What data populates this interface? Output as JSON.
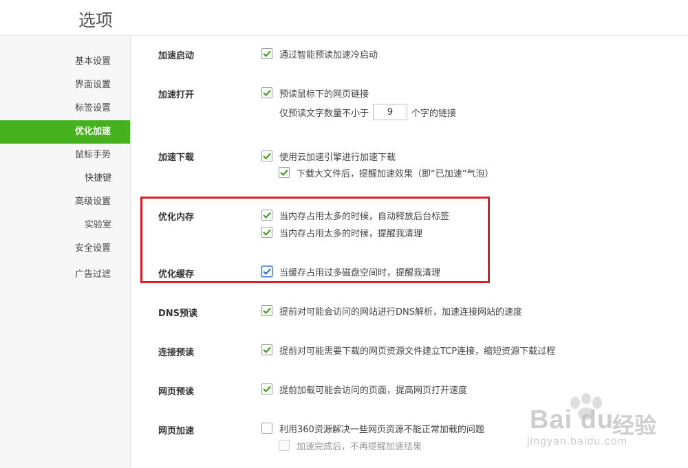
{
  "header": {
    "title": "选项"
  },
  "sidebar": {
    "items": [
      {
        "label": "基本设置"
      },
      {
        "label": "界面设置"
      },
      {
        "label": "标签设置"
      },
      {
        "label": "优化加速",
        "active": true
      },
      {
        "label": "鼠标手势"
      },
      {
        "label": "快捷键"
      },
      {
        "label": "高级设置"
      },
      {
        "label": "实验室"
      },
      {
        "label": "安全设置"
      },
      {
        "label": "广告过滤"
      }
    ]
  },
  "sections": {
    "accel_start": {
      "label": "加速启动",
      "opt1": {
        "label": "通过智能预读加速冷启动",
        "checked": true
      }
    },
    "accel_open": {
      "label": "加速打开",
      "opt1": {
        "label": "预读鼠标下的网页链接",
        "checked": true
      },
      "prefix": "仅预读文字数量不小于",
      "value": "9",
      "suffix": "个字的链接"
    },
    "accel_download": {
      "label": "加速下载",
      "opt1": {
        "label": "使用云加速引擎进行加速下载",
        "checked": true
      },
      "opt2": {
        "label": "下载大文件后，提醒加速效果（即“已加速”气泡）",
        "checked": true
      }
    },
    "optimize_memory": {
      "label": "优化内存",
      "opt1": {
        "label": "当内存占用太多的时候，自动释放后台标签",
        "checked": true
      },
      "opt2": {
        "label": "当内存占用太多的时候，提醒我清理",
        "checked": true
      }
    },
    "optimize_cache": {
      "label": "优化缓存",
      "opt1": {
        "label": "当缓存占用过多磁盘空间时，提醒我清理",
        "checked": true
      }
    },
    "dns_prefetch": {
      "label": "DNS预读",
      "opt1": {
        "label": "提前对可能会访问的网站进行DNS解析，加速连接网站的速度",
        "checked": true
      }
    },
    "connection_prefetch": {
      "label": "连接预读",
      "opt1": {
        "label": "提前对可能需要下载的网页资源文件建立TCP连接，缩短资源下载过程",
        "checked": true
      }
    },
    "page_prefetch": {
      "label": "网页预读",
      "opt1": {
        "label": "提前加载可能会访问的页面，提高网页打开速度",
        "checked": true
      }
    },
    "page_accel": {
      "label": "网页加速",
      "opt1": {
        "label": "利用360资源解决一些网页资源不能正常加载的问题",
        "checked": false
      },
      "opt2": {
        "label": "加速完成后，不再提醒加速结果",
        "checked": false
      }
    }
  },
  "watermark": {
    "brand": "Bai du",
    "cn": "经验",
    "url": "jingyan.baidu.com"
  },
  "colors": {
    "accent": "#46b11e",
    "check": "#3aa517",
    "highlight": "#e11b22"
  }
}
